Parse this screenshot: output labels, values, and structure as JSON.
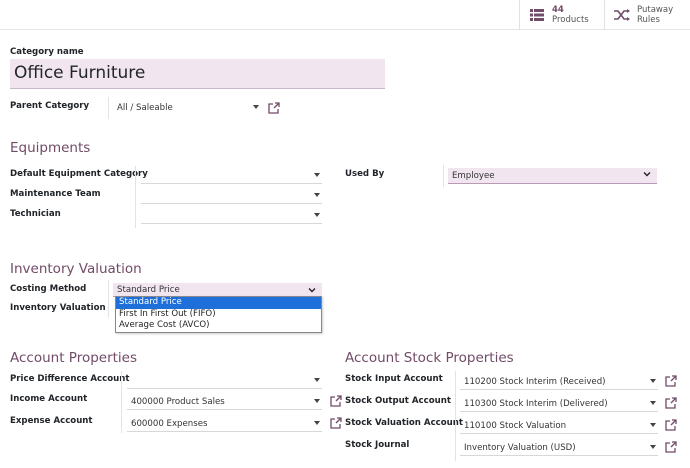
{
  "smart_buttons": {
    "products": {
      "count": "44",
      "label": "Products",
      "icon": "list-icon"
    },
    "putaway": {
      "line1": "Putaway",
      "line2": "Rules",
      "icon": "shuffle-icon"
    }
  },
  "form": {
    "category_name_label": "Category name",
    "category_name_value": "Office Furniture",
    "parent_category_label": "Parent Category",
    "parent_category_value": "All / Saleable"
  },
  "equipments": {
    "title": "Equipments",
    "default_category_label": "Default Equipment Category",
    "default_category_value": "",
    "maintenance_team_label": "Maintenance Team",
    "maintenance_team_value": "",
    "technician_label": "Technician",
    "technician_value": "",
    "used_by_label": "Used By",
    "used_by_value": "Employee"
  },
  "inventory_valuation": {
    "title": "Inventory Valuation",
    "costing_method_label": "Costing Method",
    "costing_method_value": "Standard Price",
    "inventory_valuation_label": "Inventory Valuation",
    "costing_options": [
      "Standard Price",
      "First In First Out (FIFO)",
      "Average Cost (AVCO)"
    ]
  },
  "account_properties": {
    "title": "Account Properties",
    "price_difference_label": "Price Difference Account",
    "price_difference_value": "",
    "income_label": "Income Account",
    "income_value": "400000 Product Sales",
    "expense_label": "Expense Account",
    "expense_value": "600000 Expenses"
  },
  "account_stock_properties": {
    "title": "Account Stock Properties",
    "stock_input_label": "Stock Input Account",
    "stock_input_value": "110200 Stock Interim (Received)",
    "stock_output_label": "Stock Output Account",
    "stock_output_value": "110300 Stock Interim (Delivered)",
    "stock_valuation_label": "Stock Valuation Account",
    "stock_valuation_value": "110100 Stock Valuation",
    "stock_journal_label": "Stock Journal",
    "stock_journal_value": "Inventory Valuation (USD)"
  },
  "colors": {
    "accent": "#714b67",
    "field_bg": "#f1e6f0",
    "selected_option": "#1e6fd9"
  }
}
